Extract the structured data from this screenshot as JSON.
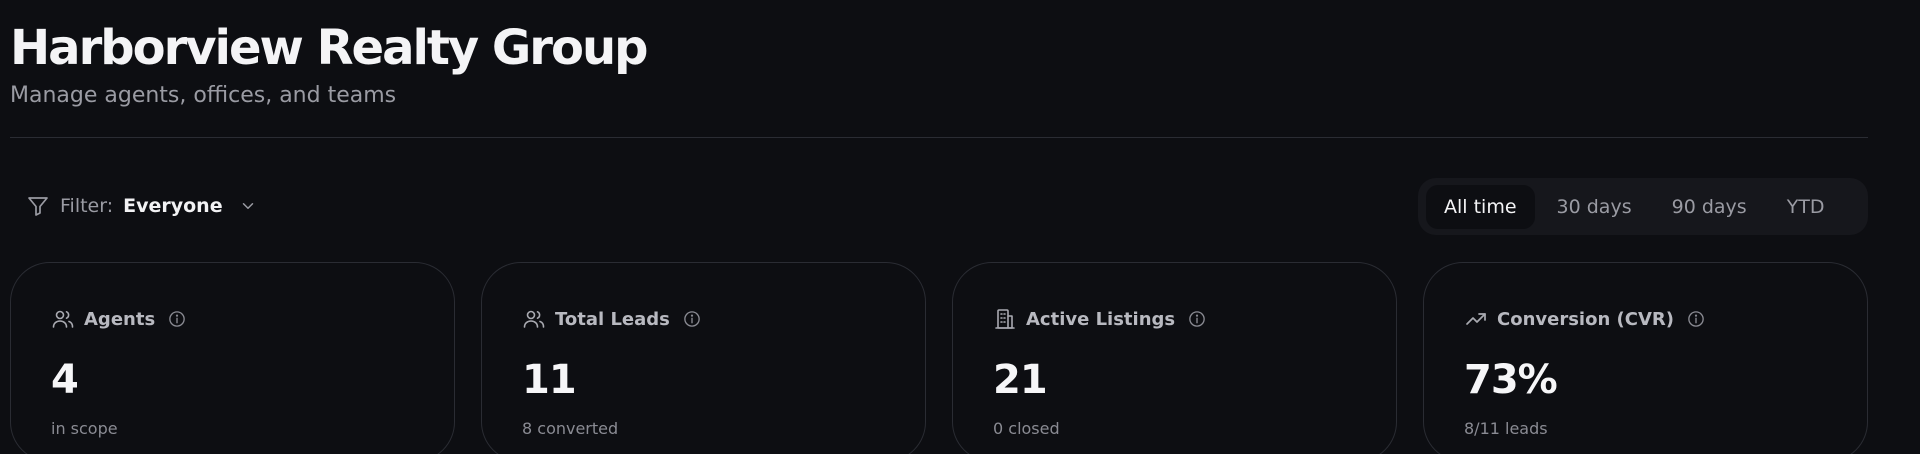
{
  "header": {
    "title": "Harborview Realty Group",
    "subtitle": "Manage agents, offices, and teams"
  },
  "filter": {
    "label": "Filter:",
    "value": "Everyone",
    "icon": "funnel-icon"
  },
  "range": {
    "options": [
      "All time",
      "30 days",
      "90 days",
      "YTD"
    ],
    "selected": "All time"
  },
  "cards": [
    {
      "title": "Agents",
      "icon": "users-icon",
      "value": "4",
      "sub": "in scope"
    },
    {
      "title": "Total Leads",
      "icon": "user-leads-icon",
      "value": "11",
      "sub": "8 converted"
    },
    {
      "title": "Active Listings",
      "icon": "building-icon",
      "value": "21",
      "sub": "0 closed"
    },
    {
      "title": "Conversion (CVR)",
      "icon": "trending-up-icon",
      "value": "73%",
      "sub": "8/11 leads"
    }
  ],
  "colors": {
    "background": "#0d0e12",
    "border": "#2a2c33",
    "muted_text": "#9a9ba3",
    "primary_text": "#f4f4f6"
  }
}
